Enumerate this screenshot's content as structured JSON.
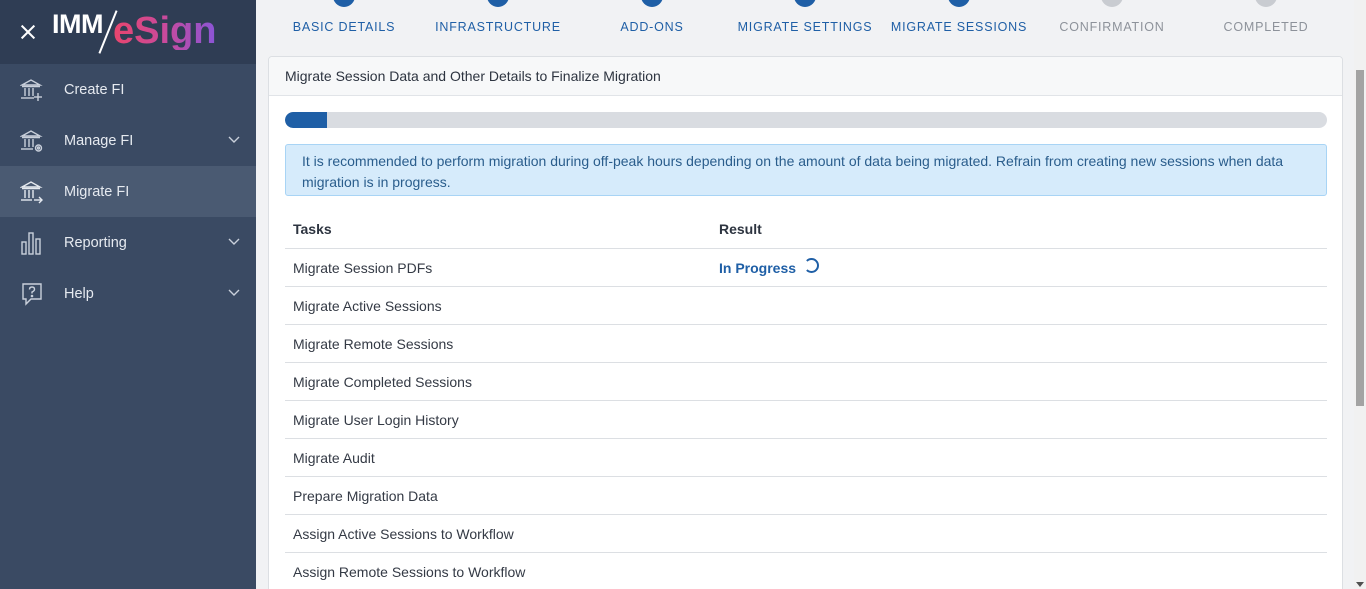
{
  "brand": {
    "logo_left": "IMM",
    "logo_right": "eSign"
  },
  "sidebar": {
    "items": [
      {
        "label": "Create FI",
        "icon": "bank-plus-icon",
        "expandable": false
      },
      {
        "label": "Manage FI",
        "icon": "bank-gear-icon",
        "expandable": true
      },
      {
        "label": "Migrate FI",
        "icon": "bank-arrow-icon",
        "expandable": false,
        "active": true
      },
      {
        "label": "Reporting",
        "icon": "bar-chart-icon",
        "expandable": true
      },
      {
        "label": "Help",
        "icon": "question-bubble-icon",
        "expandable": true
      }
    ]
  },
  "steps": [
    {
      "label": "BASIC DETAILS",
      "state": "done"
    },
    {
      "label": "INFRASTRUCTURE",
      "state": "done"
    },
    {
      "label": "ADD-ONS",
      "state": "done"
    },
    {
      "label": "MIGRATE SETTINGS",
      "state": "done"
    },
    {
      "label": "MIGRATE SESSIONS",
      "state": "current"
    },
    {
      "label": "CONFIRMATION",
      "state": "pending"
    },
    {
      "label": "COMPLETED",
      "state": "pending"
    }
  ],
  "card": {
    "title": "Migrate Session Data and Other Details to Finalize Migration",
    "progress_percent": 4,
    "alert": "It is recommended to perform migration during off-peak hours depending on the amount of data being migrated. Refrain from creating new sessions when data migration is in progress.",
    "table": {
      "headers": {
        "task": "Tasks",
        "result": "Result"
      },
      "rows": [
        {
          "task": "Migrate Session PDFs",
          "result": "In Progress"
        },
        {
          "task": "Migrate Active Sessions",
          "result": ""
        },
        {
          "task": "Migrate Remote Sessions",
          "result": ""
        },
        {
          "task": "Migrate Completed Sessions",
          "result": ""
        },
        {
          "task": "Migrate User Login History",
          "result": ""
        },
        {
          "task": "Migrate Audit",
          "result": ""
        },
        {
          "task": "Prepare Migration Data",
          "result": ""
        },
        {
          "task": "Assign Active Sessions to Workflow",
          "result": ""
        },
        {
          "task": "Assign Remote Sessions to Workflow",
          "result": ""
        }
      ]
    }
  },
  "colors": {
    "sidebar_bg": "#3a4a63",
    "accent": "#1f5fa6",
    "alert_bg": "#d6ebfb",
    "inactive": "#8d929a"
  }
}
